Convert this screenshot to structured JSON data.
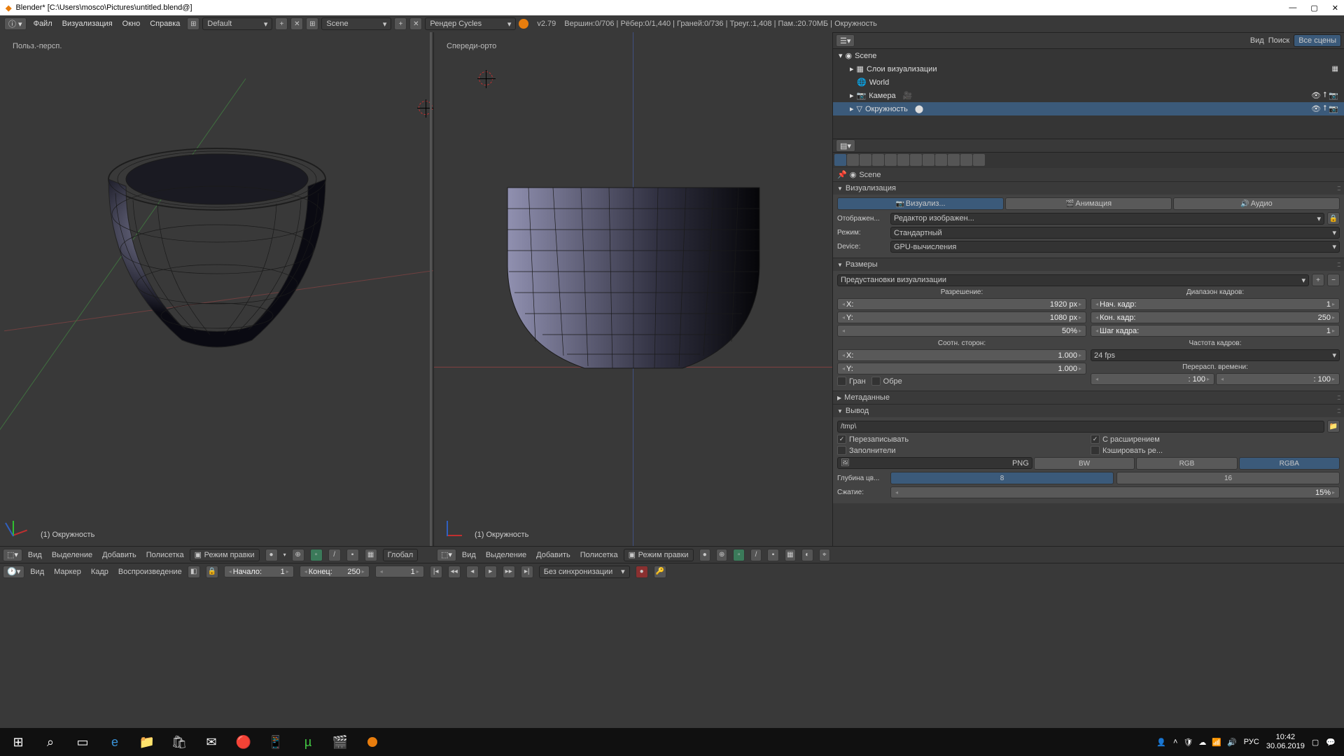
{
  "title": "Blender* [C:\\Users\\mosco\\Pictures\\untitled.blend@]",
  "topmenu": {
    "file": "Файл",
    "render": "Визуализация",
    "window": "Окно",
    "help": "Справка"
  },
  "layout": "Default",
  "scene": "Scene",
  "engine": "Рендер Cycles",
  "version": "v2.79",
  "stats": "Вершин:0/706 | Рёбер:0/1,440 | Граней:0/736 | Треуг.:1,408 | Пам.:20.70МБ | Окружность",
  "vp1": {
    "label": "Польз.-персп.",
    "obj": "(1) Окружность"
  },
  "vp2": {
    "label": "Спереди-орто",
    "obj": "(1) Окружность"
  },
  "outliner": {
    "view": "Вид",
    "search": "Поиск",
    "allscenes": "Все сцены",
    "scene": "Scene",
    "renderlayers": "Слои визуализации",
    "world": "World",
    "camera": "Камера",
    "circle": "Окружность"
  },
  "props": {
    "scene_crumb": "Scene",
    "vis_hdr": "Визуализация",
    "vis_btn": "Визуализ...",
    "anim_btn": "Анимация",
    "audio_btn": "Аудио",
    "display_lbl": "Отображен...",
    "display_val": "Редактор изображен...",
    "mode_lbl": "Режим:",
    "mode_val": "Стандартный",
    "device_lbl": "Device:",
    "device_val": "GPU-вычисления",
    "dims_hdr": "Размеры",
    "preset": "Предустановки визуализации",
    "res_lbl": "Разрешение:",
    "range_lbl": "Диапазон кадров:",
    "x": "X:",
    "x_val": "1920 px",
    "y": "Y:",
    "y_val": "1080 px",
    "pct": "50%",
    "start": "Нач. кадр:",
    "start_v": "1",
    "end": "Кон. кадр:",
    "end_v": "250",
    "step": "Шаг кадра:",
    "step_v": "1",
    "aspect_lbl": "Соотн. сторон:",
    "ax": "X:",
    "ax_v": "1.000",
    "ay": "Y:",
    "ay_v": "1.000",
    "fps_lbl": "Частота кадров:",
    "fps_val": "24 fps",
    "remap": "Перерасп. времени:",
    "r1": ": 100",
    "r2": ": 100",
    "border": "Гран",
    "crop": "Обре",
    "meta_hdr": "Метаданные",
    "output_hdr": "Вывод",
    "outpath": "/tmp\\",
    "overwrite": "Перезаписывать",
    "ext": "С расширением",
    "placeholders": "Заполнители",
    "cache": "Кэшировать ре...",
    "fmt": "PNG",
    "bw": "BW",
    "rgb": "RGB",
    "rgba": "RGBA",
    "depth_lbl": "Глубина цв...",
    "d8": "8",
    "d16": "16",
    "comp_lbl": "Сжатие:",
    "comp_v": "15%"
  },
  "hdr3d": {
    "view": "Вид",
    "select": "Выделение",
    "add": "Добавить",
    "mesh": "Полисетка",
    "mode": "Режим правки",
    "orient": "Глобал"
  },
  "tl": {
    "view": "Вид",
    "marker": "Маркер",
    "frame": "Кадр",
    "playback": "Воспроизведение",
    "start": "Начало:",
    "start_v": "1",
    "end": "Конец:",
    "end_v": "250",
    "cur": "1",
    "sync": "Без синхронизации"
  },
  "taskbar": {
    "lang": "РУС",
    "time": "10:42",
    "date": "30.06.2019"
  }
}
